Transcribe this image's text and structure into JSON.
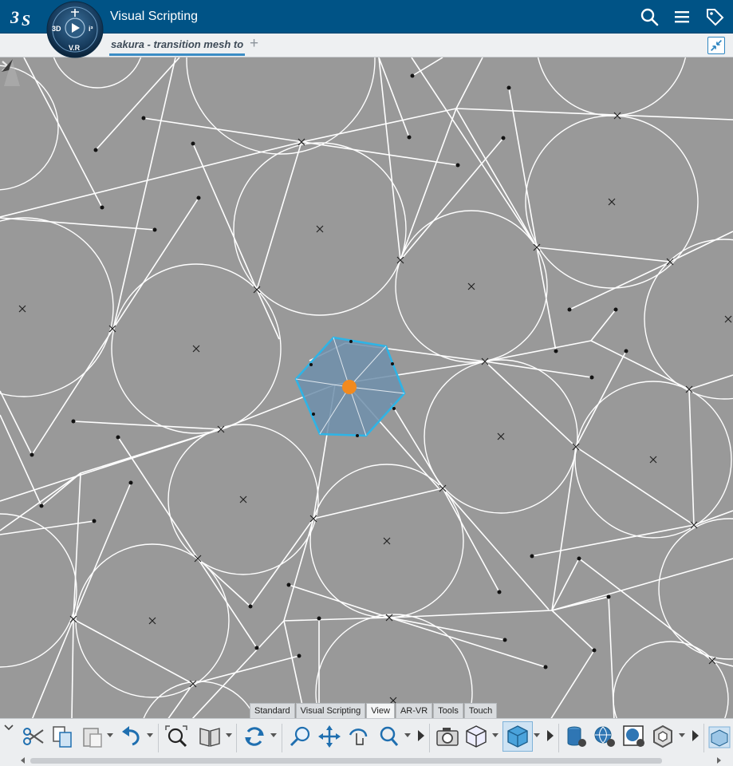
{
  "app": {
    "title": "Visual Scripting",
    "brand_logo": "3ds-logo",
    "compass_labels": {
      "left": "3D",
      "bottom": "V.R",
      "top": "🚶",
      "right": "i³"
    }
  },
  "header_icons": [
    "search-icon",
    "menu-icon",
    "tag-icon"
  ],
  "tabs": [
    {
      "label": "sakura - transition mesh to",
      "active": true
    }
  ],
  "tab_add_label": "+",
  "viewport": {
    "background": "#999999",
    "line_color": "#ffffff",
    "selection": {
      "fill": "#6f8fab",
      "stroke": "#2eb4e6",
      "handle_color": "#f28a1e"
    }
  },
  "toolbar_tabs": [
    {
      "label": "Standard",
      "active": false
    },
    {
      "label": "Visual Scripting",
      "active": false
    },
    {
      "label": "View",
      "active": true
    },
    {
      "label": "AR-VR",
      "active": false
    },
    {
      "label": "Tools",
      "active": false
    },
    {
      "label": "Touch",
      "active": false
    }
  ],
  "action_icons": [
    "cut-icon",
    "copy-icon",
    "paste-icon",
    "undo-icon",
    "fit-all-icon",
    "catalog-icon",
    "update-icon",
    "zoom-icon",
    "pan-icon",
    "rotate-icon",
    "zoom-in-out-icon",
    "capture-icon",
    "view-cube-icon",
    "shading-icon",
    "database-settings-icon",
    "globe-settings-icon",
    "render-settings-icon",
    "hexagon-icon",
    "ar-view-icon"
  ]
}
